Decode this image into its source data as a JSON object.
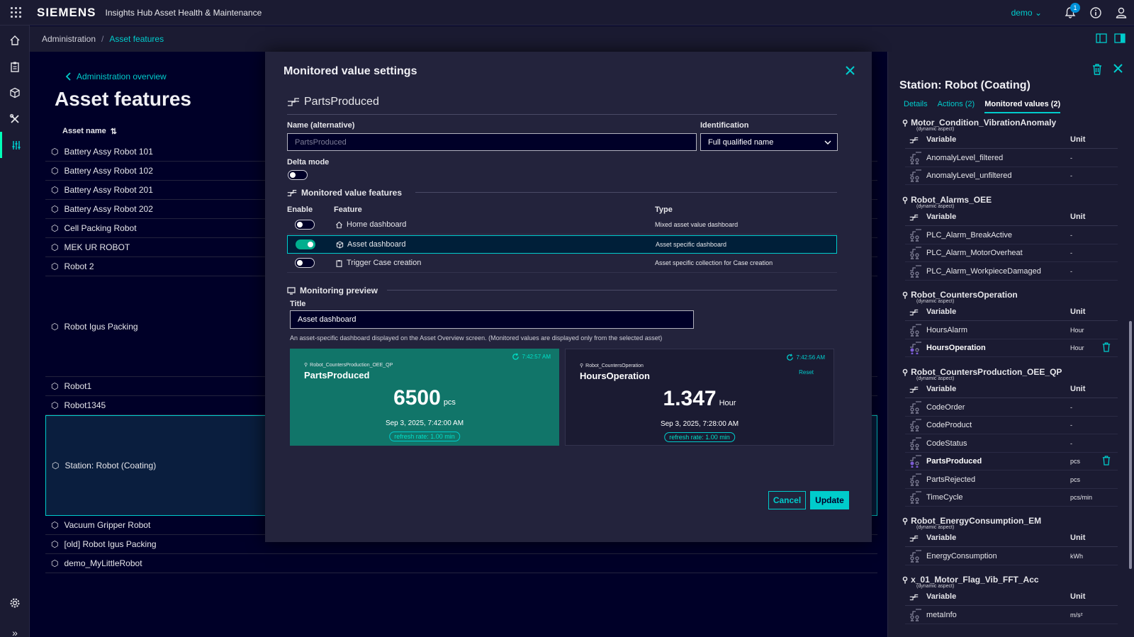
{
  "topbar": {
    "brand": "SIEMENS",
    "app_name": "Insights Hub Asset Health & Maintenance",
    "tenant": "demo",
    "notification_count": "1"
  },
  "breadcrumb": {
    "root": "Administration",
    "current": "Asset features"
  },
  "page": {
    "back_label": "Administration overview",
    "title": "Asset features",
    "column_header": "Asset name"
  },
  "assets": [
    "Battery Assy Robot 101",
    "Battery Assy Robot 102",
    "Battery Assy Robot 201",
    "Battery Assy Robot 202",
    "Cell Packing Robot",
    "MEK UR ROBOT",
    "Robot 2",
    "Robot Igus Packing",
    "Robot1",
    "Robot1345",
    "Station: Robot (Coating)",
    "Vacuum Gripper Robot",
    "[old] Robot Igus Packing",
    "demo_MyLittleRobot"
  ],
  "modal": {
    "title": "Monitored value settings",
    "variable_name": "PartsProduced",
    "name_alt_label": "Name (alternative)",
    "name_alt_placeholder": "PartsProduced",
    "identification_label": "Identification",
    "identification_value": "Full qualified name",
    "delta_label": "Delta mode",
    "features_header": "Monitored value features",
    "col_enable": "Enable",
    "col_feature": "Feature",
    "col_type": "Type",
    "features": [
      {
        "name": "Home dashboard",
        "type": "Mixed asset value dashboard",
        "enabled": false
      },
      {
        "name": "Asset dashboard",
        "type": "Asset specific dashboard",
        "enabled": true
      },
      {
        "name": "Trigger Case creation",
        "type": "Asset specific collection for Case creation",
        "enabled": false
      }
    ],
    "preview_header": "Monitoring preview",
    "title_label": "Title",
    "title_value": "Asset dashboard",
    "help_text": "An asset-specific dashboard displayed on the Asset Overview screen. (Monitored values are displayed only from the selected asset)",
    "cards": [
      {
        "aspect": "Robot_CountersProduction_OEE_QP",
        "name": "PartsProduced",
        "time": "7:42:57 AM",
        "value": "6500",
        "unit": "pcs",
        "date": "Sep 3, 2025, 7:42:00 AM",
        "refresh": "refresh rate: 1.00 min"
      },
      {
        "aspect": "Robot_CountersOperation",
        "name": "HoursOperation",
        "time": "7:42:56 AM",
        "reset": "Reset",
        "value": "1.347",
        "unit": "Hour",
        "date": "Sep 3, 2025, 7:28:00 AM",
        "refresh": "refresh rate: 1.00 min"
      }
    ],
    "cancel": "Cancel",
    "update": "Update"
  },
  "panel": {
    "title": "Station: Robot (Coating)",
    "tabs": [
      "Details",
      "Actions (2)",
      "Monitored values (2)"
    ],
    "dyn_label": "(dynamic aspect)",
    "col_variable": "Variable",
    "col_unit": "Unit",
    "aspects": [
      {
        "name": "Motor_Condition_VibrationAnomaly",
        "rows": [
          {
            "v": "AnomalyLevel_filtered",
            "u": "-"
          },
          {
            "v": "AnomalyLevel_unfiltered",
            "u": "-"
          }
        ]
      },
      {
        "name": "Robot_Alarms_OEE",
        "rows": [
          {
            "v": "PLC_Alarm_BreakActive",
            "u": "-"
          },
          {
            "v": "PLC_Alarm_MotorOverheat",
            "u": "-"
          },
          {
            "v": "PLC_Alarm_WorkpieceDamaged",
            "u": "-"
          }
        ]
      },
      {
        "name": "Robot_CountersOperation",
        "rows": [
          {
            "v": "HoursAlarm",
            "u": "Hour"
          },
          {
            "v": "HoursOperation",
            "u": "Hour",
            "monitored": true
          }
        ]
      },
      {
        "name": "Robot_CountersProduction_OEE_QP",
        "rows": [
          {
            "v": "CodeOrder",
            "u": "-"
          },
          {
            "v": "CodeProduct",
            "u": "-"
          },
          {
            "v": "CodeStatus",
            "u": "-"
          },
          {
            "v": "PartsProduced",
            "u": "pcs",
            "monitored": true
          },
          {
            "v": "PartsRejected",
            "u": "pcs"
          },
          {
            "v": "TimeCycle",
            "u": "pcs/min"
          }
        ]
      },
      {
        "name": "Robot_EnergyConsumption_EM",
        "rows": [
          {
            "v": "EnergyConsumption",
            "u": "kWh"
          }
        ]
      },
      {
        "name": "x_01_Motor_Flag_Vib_FFT_Acc",
        "rows": [
          {
            "v": "metaInfo",
            "u": "m/s²"
          }
        ]
      }
    ]
  },
  "colors": {
    "accent": "#00cccc",
    "background": "#000028",
    "toggle_on": "#00af8e",
    "card_teal": "#117569"
  }
}
